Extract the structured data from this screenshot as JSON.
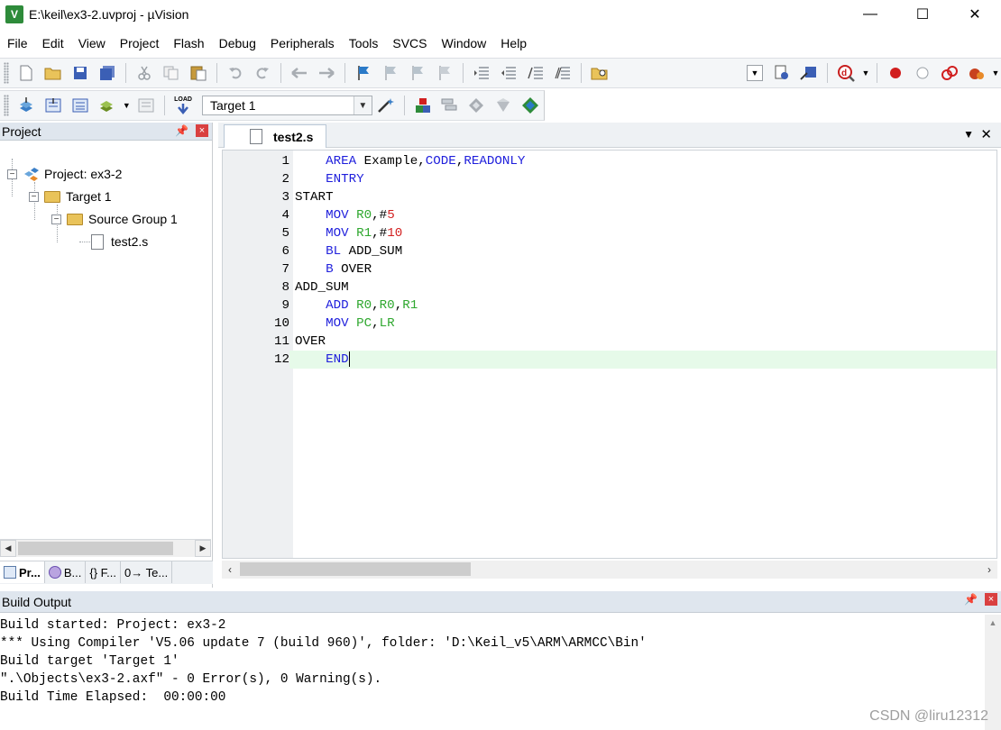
{
  "window": {
    "title": "E:\\keil\\ex3-2.uvproj - µVision",
    "icon": "keil-uvision-icon",
    "controls": {
      "minimize": "—",
      "maximize": "☐",
      "close": "✕"
    }
  },
  "menu": [
    "File",
    "Edit",
    "View",
    "Project",
    "Flash",
    "Debug",
    "Peripherals",
    "Tools",
    "SVCS",
    "Window",
    "Help"
  ],
  "toolbar2": {
    "target": "Target 1",
    "load_label": "LOAD"
  },
  "project_panel": {
    "title": "Project",
    "pin": "📌",
    "close": "×",
    "tree": {
      "project": "Project: ex3-2",
      "target": "Target 1",
      "group": "Source Group 1",
      "file": "test2.s"
    },
    "tabs": [
      {
        "label": "Pr...",
        "icon": "project-tab-icon"
      },
      {
        "label": "B...",
        "icon": "books-tab-icon"
      },
      {
        "label": "{} F...",
        "icon": "functions-tab-icon"
      },
      {
        "label": "0→ Te...",
        "icon": "templates-tab-icon"
      }
    ]
  },
  "editor": {
    "tab_label": "test2.s",
    "lines": [
      {
        "n": "1",
        "text": "    AREA Example,CODE,READONLY"
      },
      {
        "n": "2",
        "text": "    ENTRY"
      },
      {
        "n": "3",
        "text": "START"
      },
      {
        "n": "4",
        "text": "    MOV R0,#5"
      },
      {
        "n": "5",
        "text": "    MOV R1,#10"
      },
      {
        "n": "6",
        "text": "    BL ADD_SUM"
      },
      {
        "n": "7",
        "text": "    B OVER"
      },
      {
        "n": "8",
        "text": "ADD_SUM"
      },
      {
        "n": "9",
        "text": "    ADD R0,R0,R1"
      },
      {
        "n": "10",
        "text": "    MOV PC,LR"
      },
      {
        "n": "11",
        "text": "OVER"
      },
      {
        "n": "12",
        "text": "    END"
      }
    ]
  },
  "build_output": {
    "title": "Build Output",
    "lines": [
      "Build started: Project: ex3-2",
      "*** Using Compiler 'V5.06 update 7 (build 960)', folder: 'D:\\Keil_v5\\ARM\\ARMCC\\Bin'",
      "Build target 'Target 1'",
      "\".\\Objects\\ex3-2.axf\" - 0 Error(s), 0 Warning(s).",
      "Build Time Elapsed:  00:00:00"
    ]
  },
  "watermark": "CSDN @liru12312",
  "colors": {
    "keyword": "#1f1fdc",
    "register": "#2ea72e",
    "number": "#d21f1f",
    "current_line": "#e6fae9"
  }
}
